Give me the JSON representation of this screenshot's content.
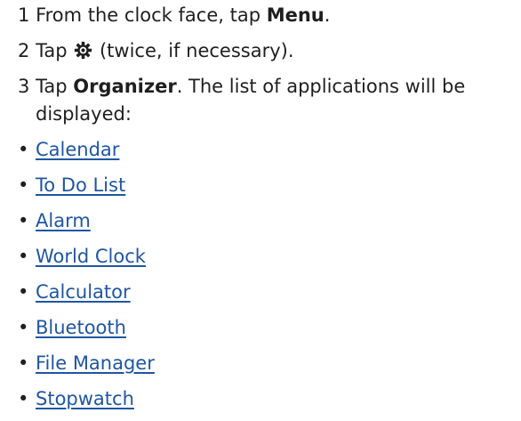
{
  "steps": [
    {
      "num": "1",
      "before": "From the clock face, tap ",
      "bold": "Menu",
      "after": "."
    },
    {
      "num": "2",
      "before": "Tap ",
      "icon": "gear-icon",
      "after": " (twice, if necessary)."
    },
    {
      "num": "3",
      "before": "Tap ",
      "bold": "Organizer",
      "after": ". The list of applications will be displayed:"
    }
  ],
  "bullet_glyph": "•",
  "apps": [
    "Calendar",
    "To Do List",
    "Alarm",
    "World Clock",
    "Calculator",
    "Bluetooth",
    "File Manager",
    "Stopwatch"
  ],
  "colors": {
    "text": "#1f1f1f",
    "link": "#1f56a3"
  }
}
